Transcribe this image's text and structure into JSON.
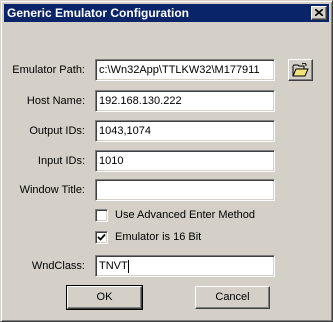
{
  "window": {
    "title": "Generic Emulator Configuration",
    "close_icon": "close-icon"
  },
  "fields": {
    "emulator_path": {
      "label": "Emulator Path:",
      "value": "c:\\Wn32App\\TTLKW32\\M177911"
    },
    "host_name": {
      "label": "Host Name:",
      "value": "192.168.130.222"
    },
    "output_ids": {
      "label": "Output IDs:",
      "value": "1043,1074"
    },
    "input_ids": {
      "label": "Input IDs:",
      "value": "1010"
    },
    "window_title": {
      "label": "Window Title:",
      "value": ""
    },
    "wnd_class": {
      "label": "WndClass:",
      "value": "TNVT"
    }
  },
  "browse_icon": "open-folder-icon",
  "options": {
    "advanced_enter": {
      "label": "Use Advanced Enter Method",
      "checked": false
    },
    "emulator_16bit": {
      "label": "Emulator is 16 Bit",
      "checked": true
    }
  },
  "buttons": {
    "ok": "OK",
    "cancel": "Cancel"
  },
  "colors": {
    "titlebar": "#0a246a",
    "face": "#d4d0c8"
  }
}
